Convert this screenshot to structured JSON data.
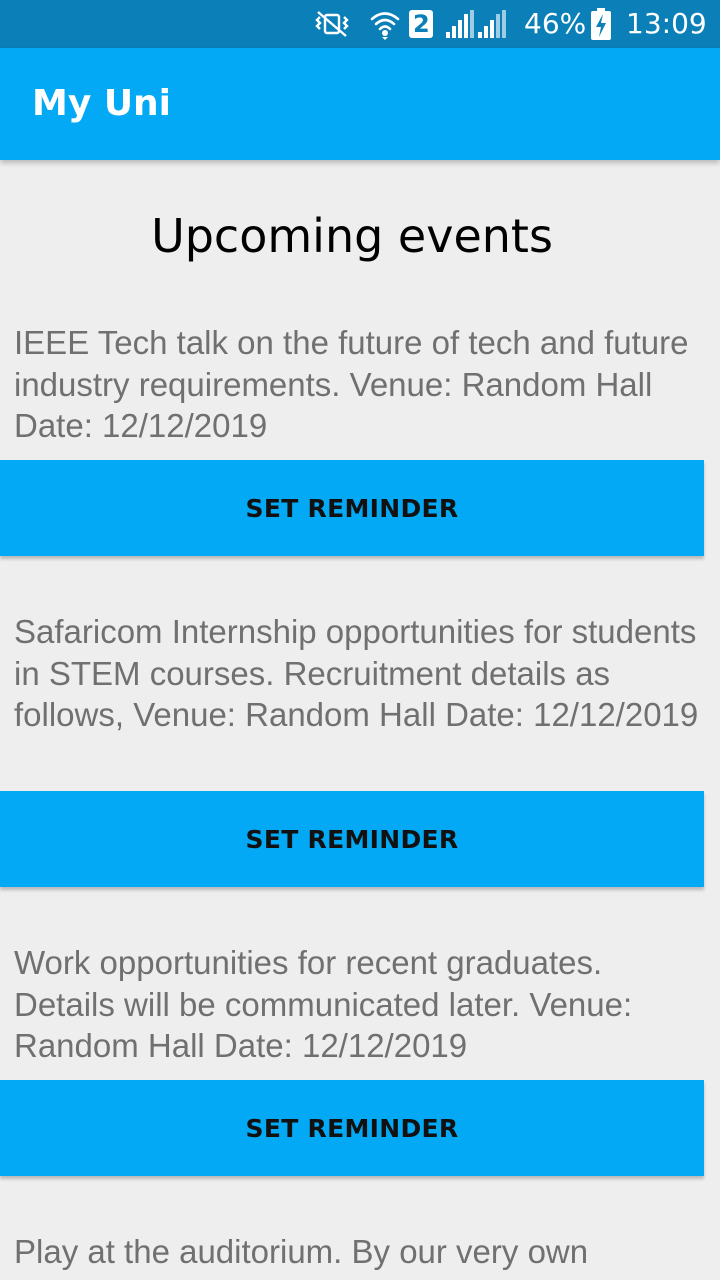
{
  "status_bar": {
    "battery_percent": "46%",
    "time": "13:09",
    "sim_badge": "2",
    "icons": [
      "mute-vibrate-icon",
      "wifi-icon",
      "sim-2-icon",
      "signal-icon",
      "signal-icon",
      "battery-charging-icon"
    ]
  },
  "app_bar": {
    "title": "My Uni"
  },
  "main": {
    "heading": "Upcoming events",
    "events": [
      {
        "description": "IEEE Tech talk on the future of tech and future industry requirements. Venue: Random Hall Date: 12/12/2019",
        "button_label": "SET REMINDER"
      },
      {
        "description": "Safaricom Internship opportunities for students in STEM courses. Recruitment details as follows, Venue: Random Hall Date: 12/12/2019",
        "button_label": "SET REMINDER"
      },
      {
        "description": "Work opportunities for recent graduates. Details will be communicated later. Venue: Random Hall Date: 12/12/2019",
        "button_label": "SET REMINDER"
      },
      {
        "description": "Play at the auditorium. By our very own"
      }
    ]
  },
  "colors": {
    "status_bar": "#0a7fb8",
    "primary": "#03a9f4",
    "background": "#eeeeee",
    "body_text": "#707070"
  }
}
